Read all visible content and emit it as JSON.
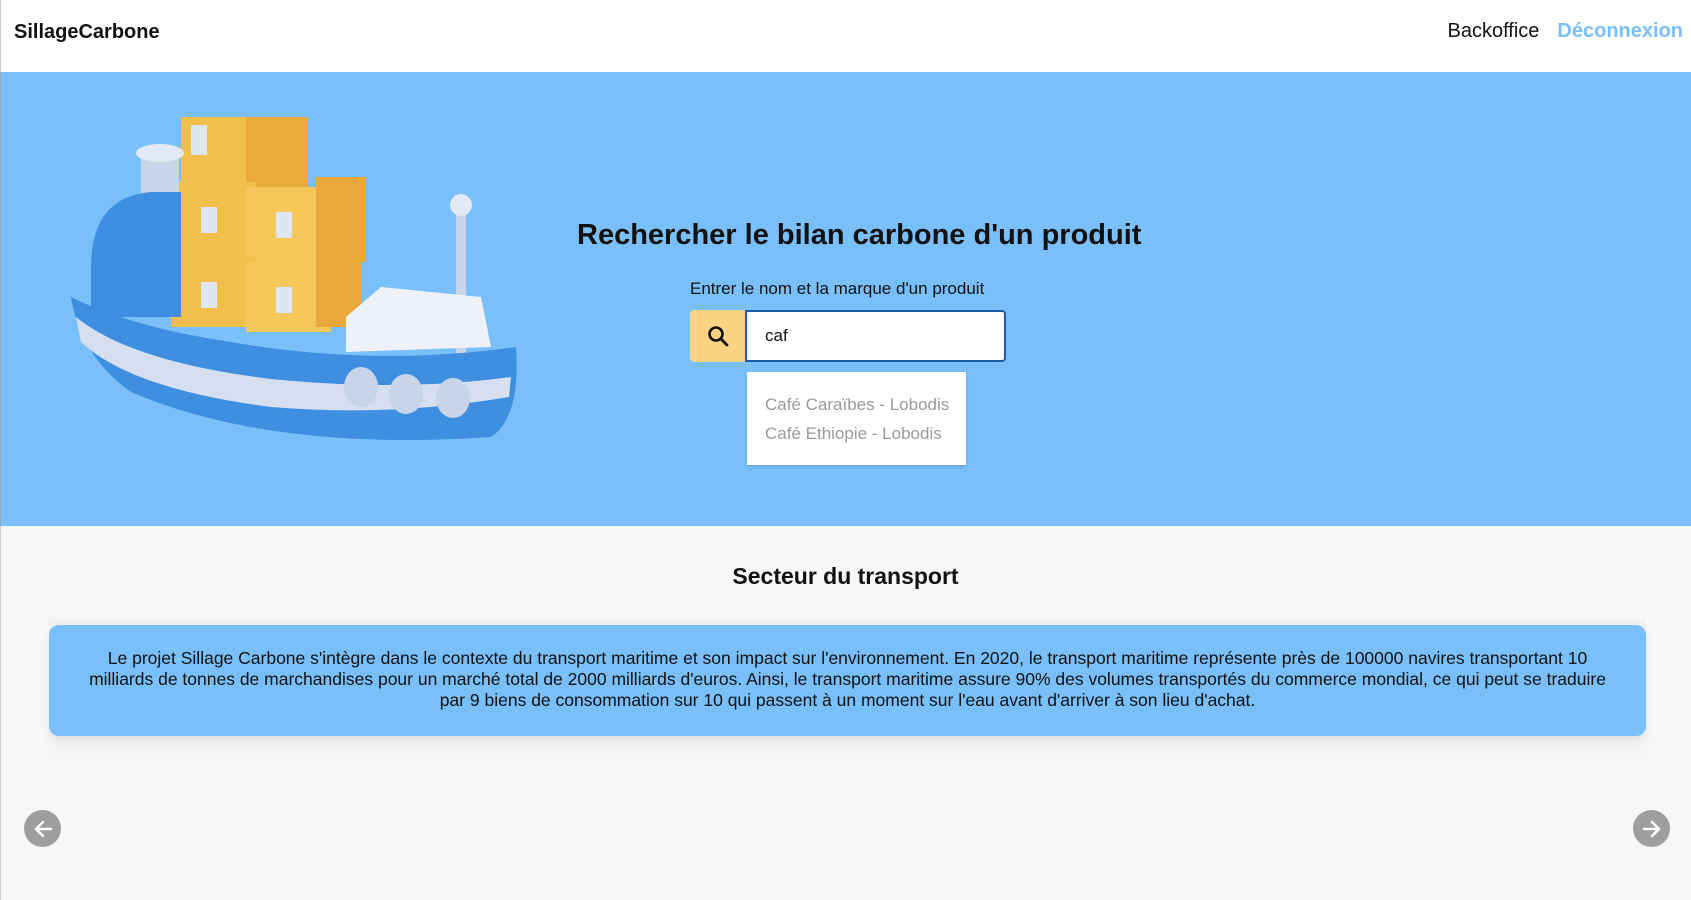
{
  "nav": {
    "brand": "SillageCarbone",
    "backoffice": "Backoffice",
    "logout": "Déconnexion"
  },
  "hero": {
    "title": "Rechercher le bilan carbone d'un produit",
    "label": "Entrer le nom et la marque d'un produit",
    "search_value": "caf",
    "suggestions": [
      "Café Caraïbes - Lobodis",
      "Café Ethiopie - Lobodis"
    ]
  },
  "section": {
    "title": "Secteur du transport",
    "text": "Le projet Sillage Carbone s'intègre dans le contexte du transport maritime et son impact sur l'environnement. En 2020, le transport maritime représente près de 100000 navires transportant 10 milliards de tonnes de marchandises pour un marché total de 2000 milliards d'euros. Ainsi, le transport maritime assure 90% des volumes transportés du commerce mondial, ce qui peut se traduire par 9 biens de consommation sur 10 qui passent à un moment sur l'eau avant d'arriver à son lieu d'achat."
  },
  "icons": {
    "search": "search-icon",
    "prev": "arrow-left-icon",
    "next": "arrow-right-icon",
    "hero_image": "cargo-ship-illustration"
  },
  "colors": {
    "primary": "#79bff9",
    "search_button": "#fcd283",
    "logout": "#79bff9"
  }
}
